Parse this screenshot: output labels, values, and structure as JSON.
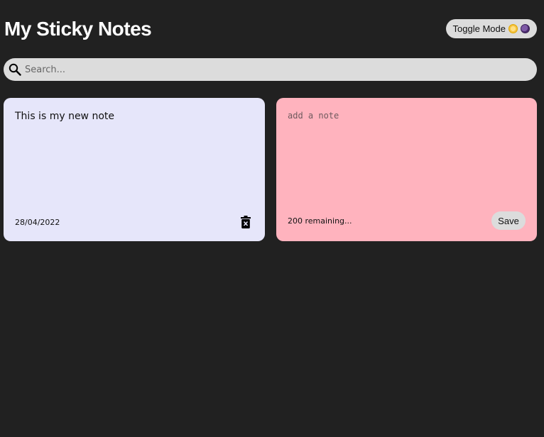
{
  "header": {
    "title": "My Sticky Notes",
    "toggle_label": "Toggle Mode",
    "toggle_icons": [
      "sun-icon",
      "moon-icon"
    ]
  },
  "search": {
    "placeholder": "Search...",
    "value": "",
    "icon": "search-icon"
  },
  "notes": [
    {
      "text": "This is my new note",
      "date": "28/04/2022",
      "color": "#e6e6fa",
      "delete_icon": "trash-icon"
    }
  ],
  "new_note": {
    "placeholder": "add a note",
    "value": "",
    "remaining_text": "200 remaining...",
    "save_label": "Save",
    "color": "#ffb3be"
  },
  "theme": {
    "background": "#212121",
    "control_bg": "#dcdcdc"
  }
}
